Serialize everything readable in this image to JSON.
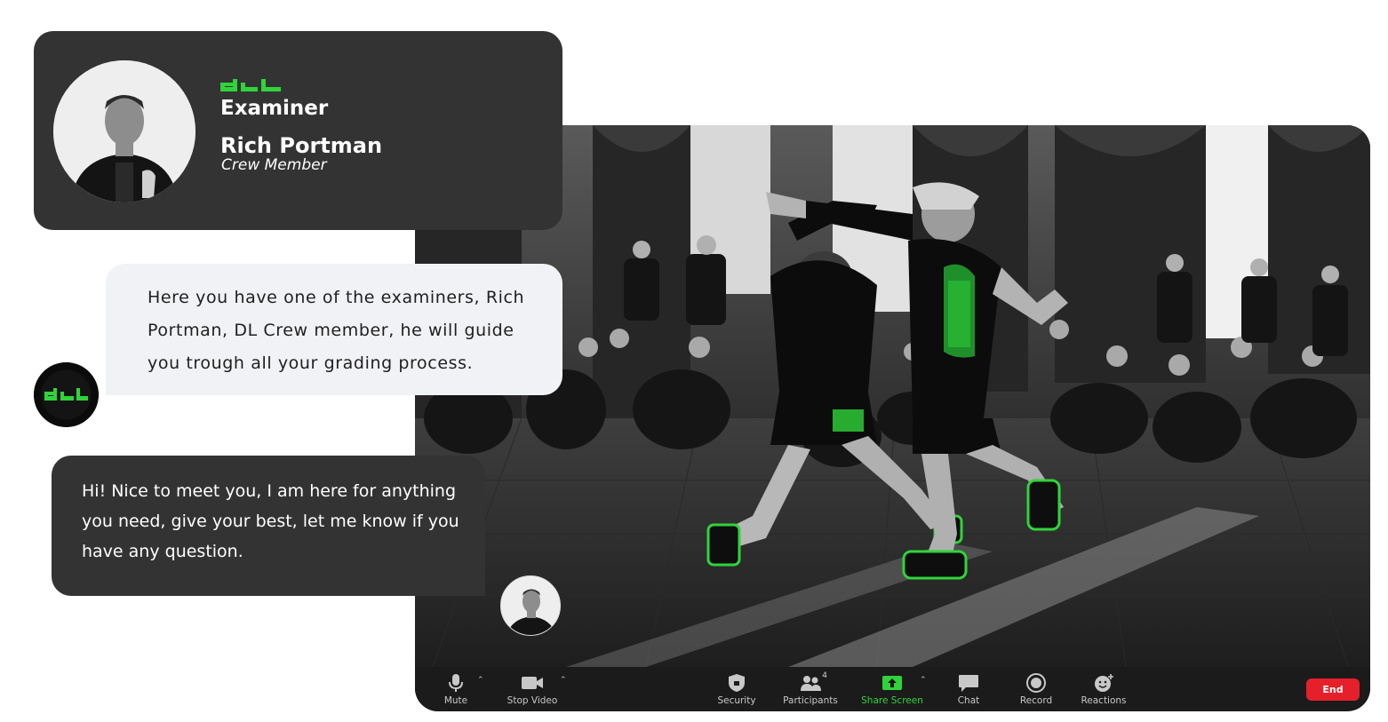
{
  "examiner_card": {
    "role": "Examiner",
    "name": "Rich Portman",
    "subtitle": "Crew Member"
  },
  "messages": [
    {
      "sender": "dl",
      "text": "Here you have one of the examiners, Rich Portman, DL Crew member, he will guide you trough all your grading process."
    },
    {
      "sender": "examiner",
      "text": "Hi! Nice to meet you, I am here for anything you need, give your best, let me know if you have any question."
    }
  ],
  "toolbar": {
    "mute": "Mute",
    "stop_video": "Stop Video",
    "security": "Security",
    "participants": "Participants",
    "participants_count": "4",
    "share_screen": "Share Screen",
    "chat": "Chat",
    "record": "Record",
    "reactions": "Reactions",
    "end": "End"
  },
  "colors": {
    "brand_green": "#2fd43a",
    "card_dark": "#333333",
    "bubble_light": "#f1f2f6",
    "toolbar_bg": "#1b1b1b",
    "end_red": "#e5202a"
  },
  "icons": [
    "dl-logo-icon",
    "microphone-icon",
    "video-camera-icon",
    "shield-icon",
    "participants-icon",
    "share-screen-icon",
    "chat-icon",
    "record-icon",
    "reactions-icon",
    "caret-up-icon"
  ]
}
